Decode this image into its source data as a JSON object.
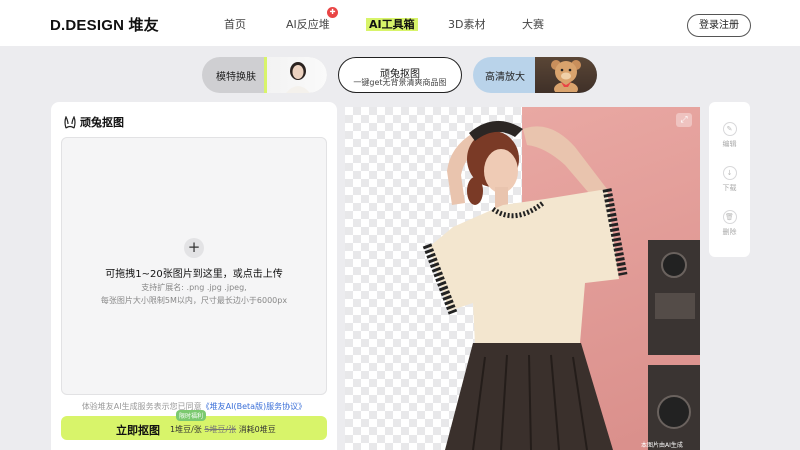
{
  "header": {
    "logo": "D.DESIGN 堆友",
    "nav": [
      {
        "label": "首页"
      },
      {
        "label": "AI反应堆"
      },
      {
        "label": "AI工具箱"
      },
      {
        "label": "3D素材"
      },
      {
        "label": "大赛"
      }
    ],
    "active_nav": "AI工具箱",
    "login": "登录注册"
  },
  "tools": {
    "model_swap": "模特换肤",
    "cutout_title": "顽兔抠图",
    "cutout_sub": "一键get无背景清爽商品图",
    "upscale": "高清放大"
  },
  "panel": {
    "title": "顽兔抠图",
    "upload_main": "可拖拽1~20张图片到这里，或点击上传",
    "upload_ext": "支持扩展名: .png .jpg .jpeg,",
    "upload_limit": "每张图片大小限制5M以内，尺寸最长边小于6000px",
    "agree_text": "体验堆友AI生成服务表示您已同意",
    "agree_link": "《堆友AI(Beta版)服务协议》",
    "cta_label": "立即抠图",
    "limited_badge": "限时福利",
    "price_now": "1堆豆/张",
    "price_old": "5堆豆/张",
    "price_cost": "消耗0堆豆"
  },
  "preview": {
    "watermark": "本图片由AI生成"
  },
  "side_tools": [
    {
      "label": "编辑",
      "icon": "edit-icon"
    },
    {
      "label": "下载",
      "icon": "download-icon"
    },
    {
      "label": "删除",
      "icon": "trash-icon"
    }
  ],
  "colors": {
    "accent": "#d8f46a",
    "link": "#3a6fd8",
    "hot_badge": "#e94545"
  }
}
